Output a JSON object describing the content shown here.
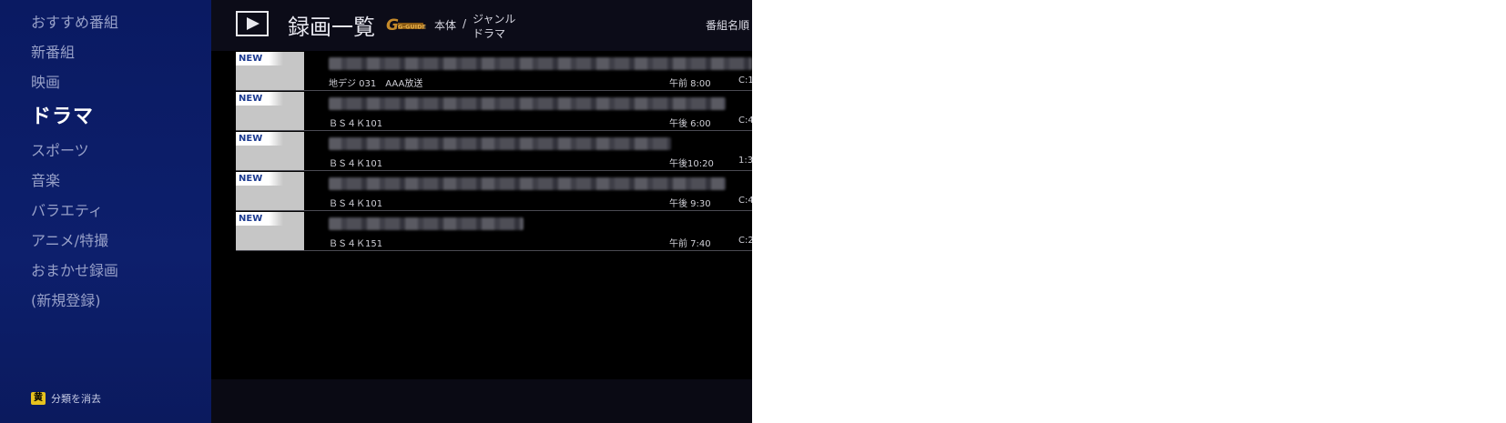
{
  "header": {
    "title": "録画一覧",
    "logo": "G-GUIDE",
    "source": "本体",
    "separator": "/",
    "genre_line1": "ジャンル",
    "genre_line2": "ドラマ",
    "sort": "番組名順"
  },
  "sidebar": {
    "items": [
      {
        "label": "おすすめ番組"
      },
      {
        "label": "新番組"
      },
      {
        "label": "映画"
      },
      {
        "label": "ドラマ"
      },
      {
        "label": "スポーツ"
      },
      {
        "label": "音楽"
      },
      {
        "label": "バラエティ"
      },
      {
        "label": "アニメ/特撮"
      },
      {
        "label": "おまかせ録画"
      },
      {
        "label": "(新規登録)"
      }
    ],
    "selected": "ドラマ",
    "footer": {
      "key": "黄",
      "label": "分類を消去"
    }
  },
  "recordings": [
    {
      "badge": "NEW",
      "channel": "地デジ 031　AAA放送",
      "time": "午前 8:00",
      "duration": "C:1"
    },
    {
      "badge": "NEW",
      "channel": "ＢＳ４Ｋ101",
      "time": "午後 6:00",
      "duration": "C:4"
    },
    {
      "badge": "NEW",
      "channel": "ＢＳ４Ｋ101",
      "time": "午後10:20",
      "duration": "1:3"
    },
    {
      "badge": "NEW",
      "channel": "ＢＳ４Ｋ101",
      "time": "午後 9:30",
      "duration": "C:4"
    },
    {
      "badge": "NEW",
      "channel": "ＢＳ４Ｋ151",
      "time": "午前 7:40",
      "duration": "C:2"
    }
  ],
  "colors": {
    "sidebar_bg": "#0b1b63",
    "accent_new": "#1b3a91",
    "yellow_key": "#e7c21f"
  }
}
